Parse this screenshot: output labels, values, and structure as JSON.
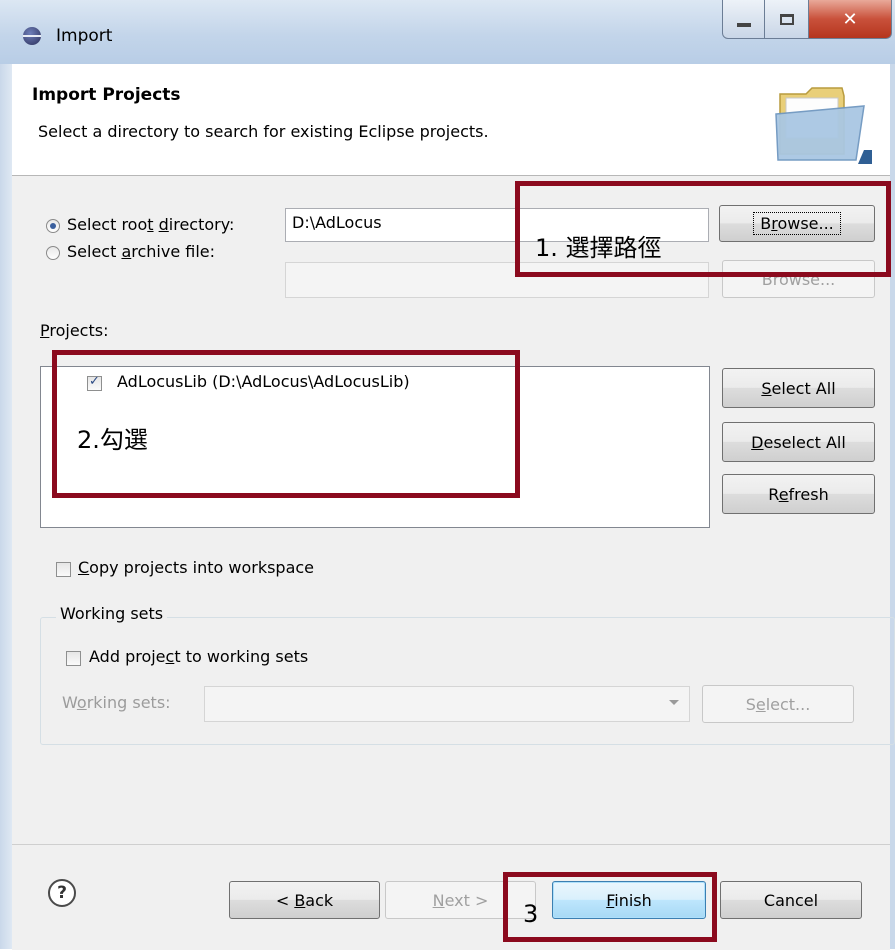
{
  "window": {
    "title": "Import"
  },
  "banner": {
    "title": "Import Projects",
    "description": "Select a directory to search for existing Eclipse projects."
  },
  "source": {
    "root_dir": {
      "label_pre": "Select roo",
      "label_mnemonic": "t",
      "label_mid": " ",
      "label_mnemonic2": "d",
      "label_post": "irectory:",
      "value": "D:\\AdLocus",
      "browse_pre": "B",
      "browse_mnemonic": "r",
      "browse_post": "owse...",
      "selected": true
    },
    "archive_file": {
      "label_pre": "Select ",
      "label_mnemonic": "a",
      "label_post": "rchive file:",
      "value": "",
      "browse_label": "Browse...",
      "selected": false
    }
  },
  "projects": {
    "label_mnemonic": "P",
    "label_post": "rojects:",
    "items": [
      {
        "label": "AdLocusLib (D:\\AdLocus\\AdLocusLib)",
        "checked": true
      }
    ],
    "select_all": {
      "mnemonic": "S",
      "post": "elect All"
    },
    "deselect_all": {
      "mnemonic": "D",
      "post": "eselect All"
    },
    "refresh": {
      "pre": "R",
      "mnemonic": "e",
      "post": "fresh"
    }
  },
  "copy_option": {
    "mnemonic": "C",
    "post": "opy projects into workspace",
    "checked": false
  },
  "working_sets": {
    "group_title": "Working sets",
    "add_pre": "Add proje",
    "add_mnemonic": "c",
    "add_post": "t to working sets",
    "add_checked": false,
    "field_pre": "W",
    "field_mnemonic": "o",
    "field_post": "rking sets:",
    "field_value": "",
    "select_pre": "S",
    "select_mnemonic": "e",
    "select_post": "lect..."
  },
  "footer": {
    "help_glyph": "?",
    "back_pre": "< ",
    "back_mnemonic": "B",
    "back_post": "ack",
    "next_mnemonic": "N",
    "next_post": "ext >",
    "finish_mnemonic": "F",
    "finish_post": "inish",
    "cancel_label": "Cancel"
  },
  "annotations": {
    "step1": "1.  選擇路徑",
    "step2": "2.勾選",
    "step3": "3",
    "color": "#8b0a1e"
  },
  "colors": {
    "titlebar": "#c3d5ea",
    "dialog_bg": "#f0f0f0",
    "default_button": "#bee6fd"
  }
}
